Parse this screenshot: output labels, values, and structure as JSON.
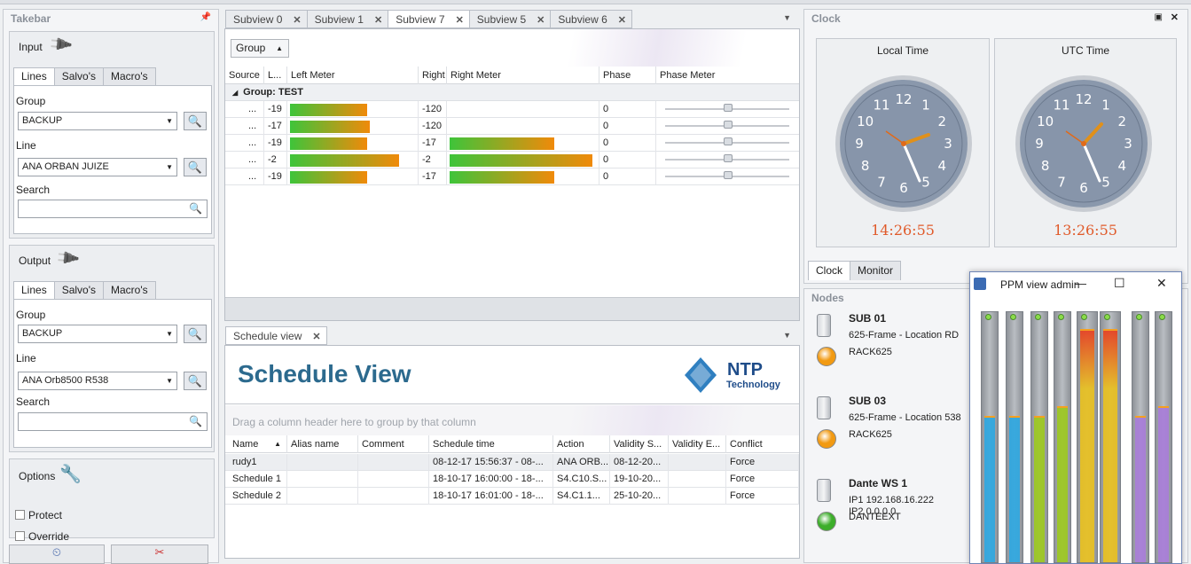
{
  "takebar": {
    "title": "Takebar",
    "input": {
      "title": "Input",
      "tabs": [
        "Lines",
        "Salvo's",
        "Macro's"
      ],
      "group_label": "Group",
      "group_value": "BACKUP",
      "line_label": "Line",
      "line_value": "ANA ORBAN JUIZE",
      "search_label": "Search",
      "search_value": ""
    },
    "output": {
      "title": "Output",
      "tabs": [
        "Lines",
        "Salvo's",
        "Macro's"
      ],
      "group_label": "Group",
      "group_value": "BACKUP",
      "line_label": "Line",
      "line_value": "ANA Orb8500 R538",
      "search_label": "Search",
      "search_value": ""
    },
    "options": {
      "title": "Options",
      "protect_label": "Protect",
      "override_label": "Override"
    }
  },
  "subviews": {
    "tabs": [
      "Subview 0",
      "Subview 1",
      "Subview 7",
      "Subview 5",
      "Subview 6"
    ],
    "active_tab": "Subview 7",
    "group_button": "Group",
    "columns": [
      "Source",
      "L...",
      "Left Meter",
      "Right",
      "Right Meter",
      "Phase",
      "Phase Meter"
    ],
    "group_row": "Group: TEST",
    "rows": [
      {
        "source": "...",
        "left": "-19",
        "right": "-120",
        "phase": "0",
        "left_level": 0.62,
        "right_level": 0.0,
        "phase_pos": 0.47
      },
      {
        "source": "...",
        "left": "-17",
        "right": "-120",
        "phase": "0",
        "left_level": 0.64,
        "right_level": 0.0,
        "phase_pos": 0.47
      },
      {
        "source": "...",
        "left": "-19",
        "right": "-17",
        "phase": "0",
        "left_level": 0.62,
        "right_level": 0.72,
        "phase_pos": 0.47
      },
      {
        "source": "...",
        "left": "-2",
        "right": "-2",
        "phase": "0",
        "left_level": 0.88,
        "right_level": 0.98,
        "phase_pos": 0.47
      },
      {
        "source": "...",
        "left": "-19",
        "right": "-17",
        "phase": "0",
        "left_level": 0.62,
        "right_level": 0.72,
        "phase_pos": 0.47
      }
    ]
  },
  "schedule": {
    "tab": "Schedule view",
    "banner_title": "Schedule View",
    "logo_name": "NTP",
    "logo_sub": "Technology",
    "group_hint": "Drag a column header here to group by that column",
    "columns": [
      "Name",
      "Alias name",
      "Comment",
      "Schedule time",
      "Action",
      "Validity S...",
      "Validity E...",
      "Conflict"
    ],
    "rows": [
      {
        "name": "rudy1",
        "alias": "",
        "comment": "",
        "time": "08-12-17 15:56:37 - 08-...",
        "action": "ANA ORB...",
        "vstart": "08-12-20...",
        "vend": "",
        "conflict": "Force"
      },
      {
        "name": "Schedule 1",
        "alias": "",
        "comment": "",
        "time": "18-10-17 16:00:00 - 18-...",
        "action": "S4.C10.S...",
        "vstart": "19-10-20...",
        "vend": "",
        "conflict": "Force"
      },
      {
        "name": "Schedule 2",
        "alias": "",
        "comment": "",
        "time": "18-10-17 16:01:00 - 18-...",
        "action": "S4.C1.1...",
        "vstart": "25-10-20...",
        "vend": "",
        "conflict": "Force"
      }
    ]
  },
  "clock": {
    "title": "Clock",
    "local_label": "Local Time",
    "local_time": "14:26:55",
    "utc_label": "UTC Time",
    "utc_time": "13:26:55",
    "tabs": [
      "Clock",
      "Monitor"
    ],
    "numerals": [
      "12",
      "1",
      "2",
      "3",
      "4",
      "5",
      "6",
      "7",
      "8",
      "9",
      "10",
      "11"
    ]
  },
  "nodes": {
    "title": "Nodes",
    "items": [
      {
        "name": "SUB 01",
        "line1": "625-Frame - Location RD",
        "line2": "",
        "tag": "RACK625",
        "status_color": "#f29a12"
      },
      {
        "name": "SUB 03",
        "line1": "625-Frame - Location 538",
        "line2": "",
        "tag": "RACK625",
        "status_color": "#f29a12"
      },
      {
        "name": "Dante WS 1",
        "line1": "IP1  192.168.16.222",
        "line2": "IP2  0.0.0.0",
        "tag": "DANTEEXT",
        "status_color": "#3cae2a"
      }
    ]
  },
  "ppm": {
    "title": "PPM view admin",
    "min": "—",
    "max": "☐",
    "close": "✕",
    "levels": [
      0.6,
      0.6,
      0.6,
      0.64,
      0.96,
      0.96,
      0.6,
      0.64
    ],
    "colors": [
      "#2ea7e0",
      "#2ea7e0",
      "#9cc820",
      "#9cc820",
      "#e8c020",
      "#e8c020",
      "#a87dd8",
      "#a87dd8"
    ]
  }
}
